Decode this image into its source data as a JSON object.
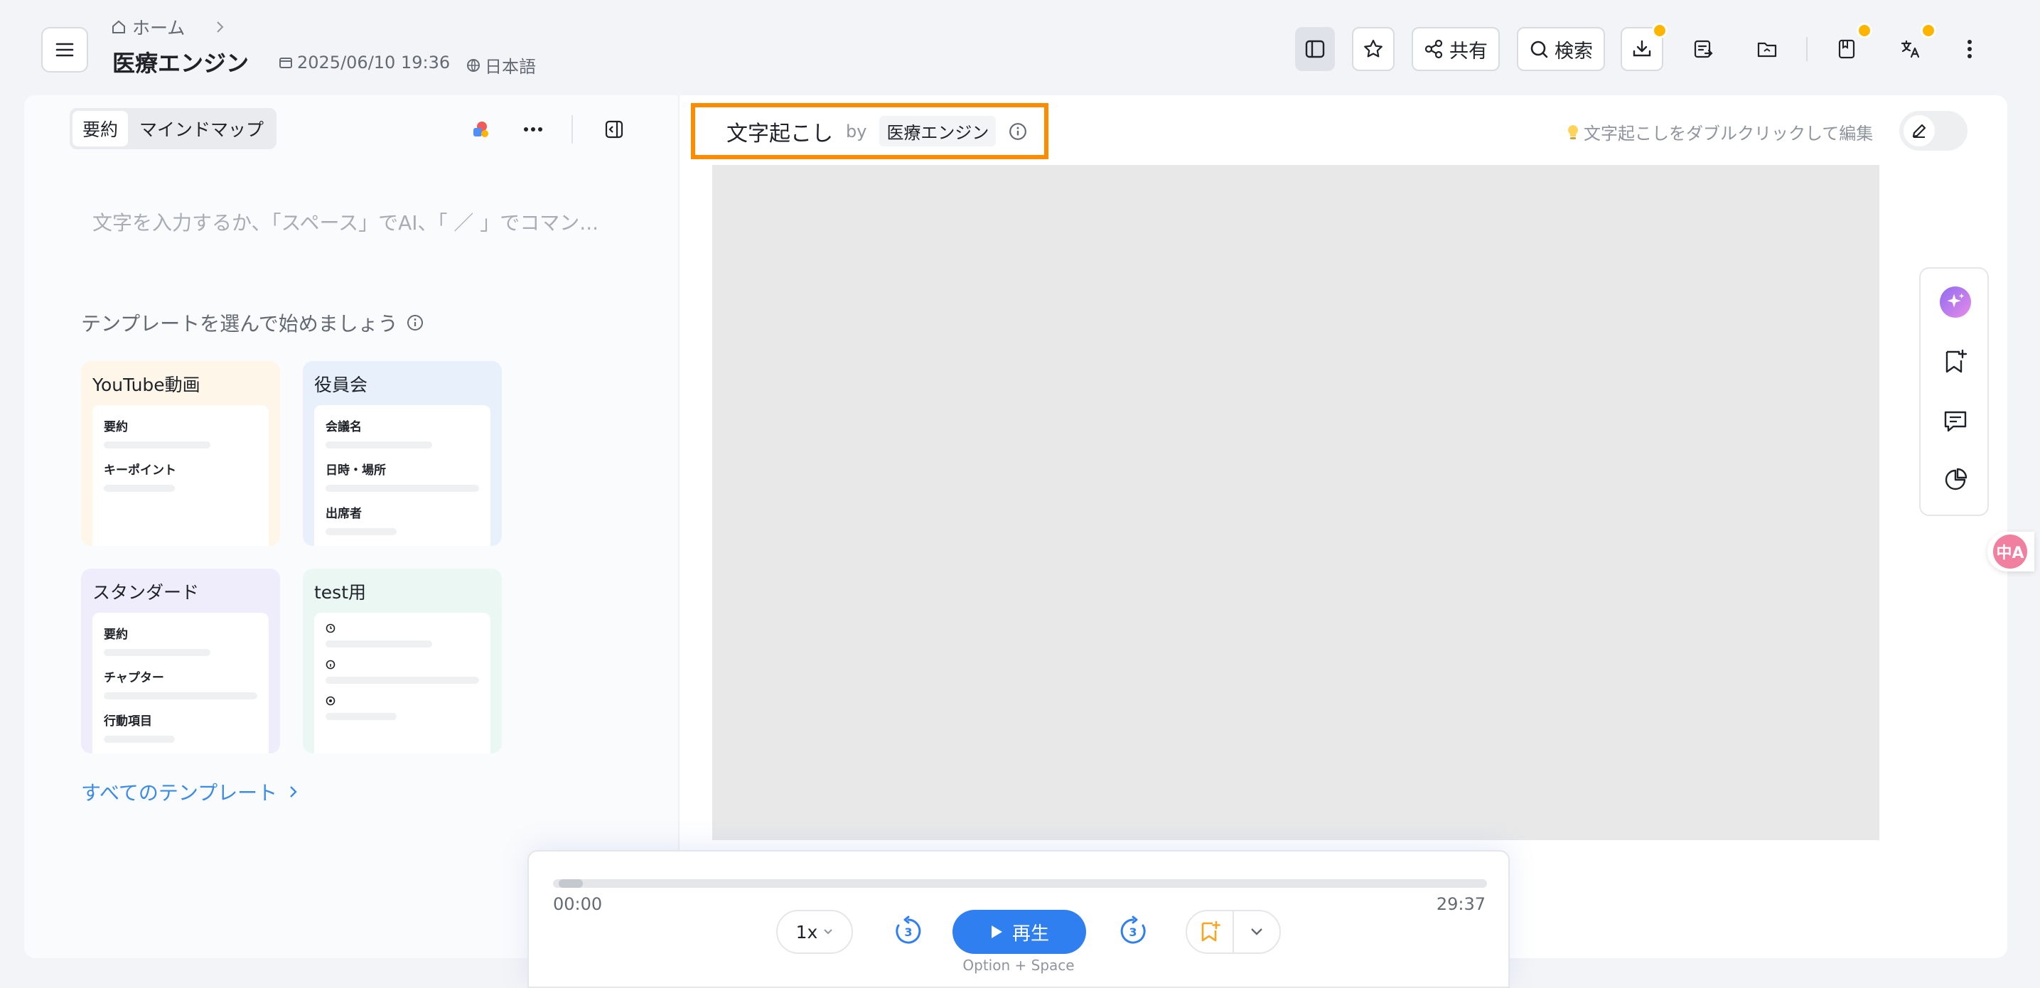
{
  "header": {
    "breadcrumb_home": "ホーム",
    "title": "医療エンジン",
    "datetime": "2025/06/10 19:36",
    "language": "日本語",
    "share_label": "共有",
    "search_label": "検索"
  },
  "summary_panel": {
    "tabs": [
      "要約",
      "マインドマップ"
    ],
    "editor_placeholder": "文字を入力するか、「スペース」でAI、「 ／ 」でコマン...",
    "templates_heading": "テンプレートを選んで始めましょう",
    "templates": [
      {
        "title": "YouTube動画",
        "lines": [
          "要約",
          "キーポイント"
        ],
        "bg": "#fff6ea"
      },
      {
        "title": "役員会",
        "lines": [
          "会議名",
          "日時・場所",
          "出席者"
        ],
        "bg": "#e8f0fc"
      },
      {
        "title": "スタンダード",
        "lines": [
          "要約",
          "チャプター",
          "行動項目"
        ],
        "bg": "#efecfb"
      },
      {
        "title": "test用",
        "lines": [
          "",
          "",
          ""
        ],
        "bg": "#eaf7f3"
      }
    ],
    "all_templates_label": "すべてのテンプレート"
  },
  "transcript": {
    "title": "文字起こし",
    "by": "by",
    "author": "医療エンジン",
    "edit_hint": "文字起こしをダブルクリックして編集"
  },
  "player": {
    "current_time": "00:00",
    "duration": "29:37",
    "speed": "1x",
    "skip_back_seconds": "3",
    "skip_forward_seconds": "3",
    "play_label": "再生",
    "shortcut_hint": "Option + Space",
    "progress_fraction": 0.01
  },
  "translate_badge": "中A",
  "colors": {
    "accent": "#2f7ff0",
    "highlight_border": "#ff8c00",
    "badge": "#ffb400",
    "ai_gradient_start": "#8e6cf0",
    "ai_gradient_end": "#e88be8"
  },
  "icons": {
    "toolbar": [
      "panel-toggle-icon",
      "star-icon",
      "share-icon",
      "search-icon",
      "download-icon",
      "export-doc-icon",
      "folder-icon",
      "notebook-icon",
      "translate-icon",
      "more-vertical-icon"
    ],
    "side_dock": [
      "ai-sparkle-icon",
      "bookmark-add-icon",
      "comment-icon",
      "pie-chart-icon"
    ]
  }
}
